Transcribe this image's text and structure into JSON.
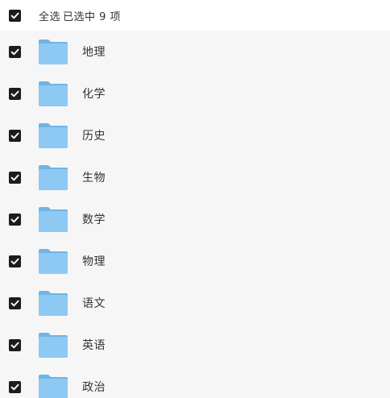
{
  "header": {
    "select_all_label": "全选",
    "selected_text": "已选中 9 项",
    "select_all_checked": true
  },
  "colors": {
    "folder_front": "#8ec9f4",
    "folder_back": "#6fb4e6",
    "checkbox": "#1c1c1c",
    "list_background": "#f6f6f7"
  },
  "items": [
    {
      "name": "地理",
      "checked": true,
      "icon": "folder-icon"
    },
    {
      "name": "化学",
      "checked": true,
      "icon": "folder-icon"
    },
    {
      "name": "历史",
      "checked": true,
      "icon": "folder-icon"
    },
    {
      "name": "生物",
      "checked": true,
      "icon": "folder-icon"
    },
    {
      "name": "数学",
      "checked": true,
      "icon": "folder-icon"
    },
    {
      "name": "物理",
      "checked": true,
      "icon": "folder-icon"
    },
    {
      "name": "语文",
      "checked": true,
      "icon": "folder-icon"
    },
    {
      "name": "英语",
      "checked": true,
      "icon": "folder-icon"
    },
    {
      "name": "政治",
      "checked": true,
      "icon": "folder-icon"
    }
  ]
}
